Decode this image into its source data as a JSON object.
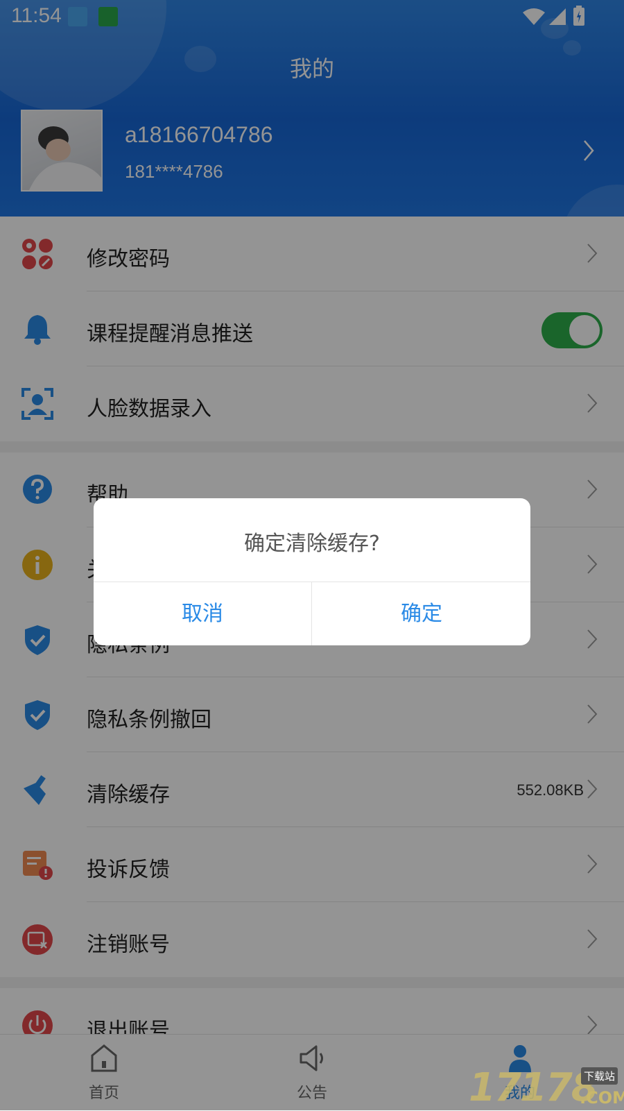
{
  "status_bar": {
    "time": "11:54"
  },
  "header": {
    "title": "我的",
    "username": "a18166704786",
    "phone": "181****4786"
  },
  "menu": {
    "change_password": "修改密码",
    "course_reminder": "课程提醒消息推送",
    "course_reminder_enabled": true,
    "face_data": "人脸数据录入",
    "help": "帮助",
    "about": "关于",
    "privacy": "隐私条例",
    "privacy_revoke": "隐私条例撤回",
    "clear_cache": "清除缓存",
    "cache_size": "552.08KB",
    "feedback": "投诉反馈",
    "cancel_account": "注销账号",
    "logout": "退出账号"
  },
  "tabs": {
    "home": "首页",
    "notice": "公告",
    "mine": "我的"
  },
  "dialog": {
    "message": "确定清除缓存?",
    "cancel": "取消",
    "confirm": "确定"
  },
  "watermark": {
    "number": "17178",
    "badge": "下载站",
    "suffix": ".COM"
  },
  "colors": {
    "header_blue": "#1f76e3",
    "toggle_green": "#2eae4b",
    "accent_blue": "#2a8ae6"
  }
}
